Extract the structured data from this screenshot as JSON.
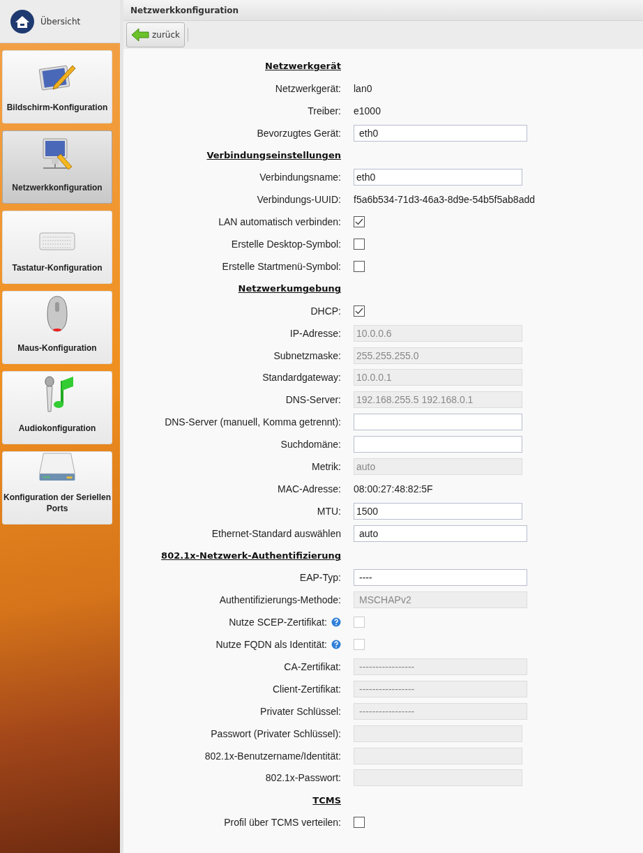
{
  "sidebar": {
    "home": {
      "label": "Übersicht"
    },
    "items": [
      {
        "label": "Bildschirm-Konfiguration",
        "kind": "display",
        "selected": false
      },
      {
        "label": "Netzwerkkonfiguration",
        "kind": "network",
        "selected": true
      },
      {
        "label": "Tastatur-Konfiguration",
        "kind": "keyboard",
        "selected": false
      },
      {
        "label": "Maus-Konfiguration",
        "kind": "mouse",
        "selected": false
      },
      {
        "label": "Audiokonfiguration",
        "kind": "audio",
        "selected": false
      },
      {
        "label": "Konfiguration der Seriellen Ports",
        "kind": "serial",
        "selected": false
      }
    ]
  },
  "window": {
    "title": "Netzwerkkonfiguration"
  },
  "toolbar": {
    "back_button": "zurück"
  },
  "form": [
    {
      "kind": "heading",
      "label": "Netzwerkgerät"
    },
    {
      "kind": "text",
      "label": "Netzwerkgerät:",
      "value": "lan0"
    },
    {
      "kind": "text",
      "label": "Treiber:",
      "value": "e1000"
    },
    {
      "kind": "select",
      "label": "Bevorzugtes Gerät:",
      "value": "eth0",
      "disabled": false
    },
    {
      "kind": "heading",
      "label": "Verbindungseinstellungen"
    },
    {
      "kind": "input",
      "label": "Verbindungsname:",
      "value": "eth0",
      "disabled": false
    },
    {
      "kind": "text",
      "label": "Verbindungs-UUID:",
      "value": "f5a6b534-71d3-46a3-8d9e-54b5f5ab8add"
    },
    {
      "kind": "checkbox",
      "label": "LAN automatisch verbinden:",
      "checked": true,
      "disabled": false
    },
    {
      "kind": "checkbox",
      "label": "Erstelle Desktop-Symbol:",
      "checked": false,
      "disabled": false
    },
    {
      "kind": "checkbox",
      "label": "Erstelle Startmenü-Symbol:",
      "checked": false,
      "disabled": false
    },
    {
      "kind": "heading",
      "label": "Netzwerkumgebung"
    },
    {
      "kind": "checkbox",
      "label": "DHCP:",
      "checked": true,
      "disabled": false
    },
    {
      "kind": "input",
      "label": "IP-Adresse:",
      "value": "10.0.0.6",
      "disabled": true
    },
    {
      "kind": "input",
      "label": "Subnetzmaske:",
      "value": "255.255.255.0",
      "disabled": true
    },
    {
      "kind": "input",
      "label": "Standardgateway:",
      "value": "10.0.0.1",
      "disabled": true
    },
    {
      "kind": "input",
      "label": "DNS-Server:",
      "value": "192.168.255.5 192.168.0.1",
      "disabled": true
    },
    {
      "kind": "input",
      "label": "DNS-Server (manuell, Komma getrennt):",
      "disabled": false
    },
    {
      "kind": "input",
      "label": "Suchdomäne:",
      "disabled": false
    },
    {
      "kind": "input",
      "label": "Metrik:",
      "value": "auto",
      "disabled": true
    },
    {
      "kind": "text",
      "label": "MAC-Adresse:",
      "value": "08:00:27:48:82:5F"
    },
    {
      "kind": "input",
      "label": "MTU:",
      "value": "1500",
      "disabled": false
    },
    {
      "kind": "select",
      "label": "Ethernet-Standard auswählen",
      "value": "auto",
      "disabled": false
    },
    {
      "kind": "heading",
      "label": "802.1x-Netzwerk-Authentifizierung"
    },
    {
      "kind": "select",
      "label": "EAP-Typ:",
      "value": "----",
      "disabled": false
    },
    {
      "kind": "select",
      "label": "Authentifizierungs-Methode:",
      "value": "MSCHAPv2",
      "disabled": true
    },
    {
      "kind": "checkbox",
      "label": "Nutze SCEP-Zertifikat:",
      "checked": false,
      "disabled": true,
      "help": true
    },
    {
      "kind": "checkbox",
      "label": "Nutze FQDN als Identität:",
      "checked": false,
      "disabled": true,
      "help": true
    },
    {
      "kind": "select",
      "label": "CA-Zertifikat:",
      "value": "-----------------",
      "disabled": true
    },
    {
      "kind": "select",
      "label": "Client-Zertifikat:",
      "value": "-----------------",
      "disabled": true
    },
    {
      "kind": "select",
      "label": "Privater Schlüssel:",
      "value": "-----------------",
      "disabled": true
    },
    {
      "kind": "input",
      "label": "Passwort (Privater Schlüssel):",
      "disabled": true
    },
    {
      "kind": "input",
      "label": "802.1x-Benutzername/Identität:",
      "disabled": true
    },
    {
      "kind": "input",
      "label": "802.1x-Passwort:",
      "disabled": true
    },
    {
      "kind": "heading",
      "label": "TCMS"
    },
    {
      "kind": "checkbox",
      "label": "Profil über TCMS verteilen:",
      "checked": false,
      "disabled": false
    }
  ]
}
